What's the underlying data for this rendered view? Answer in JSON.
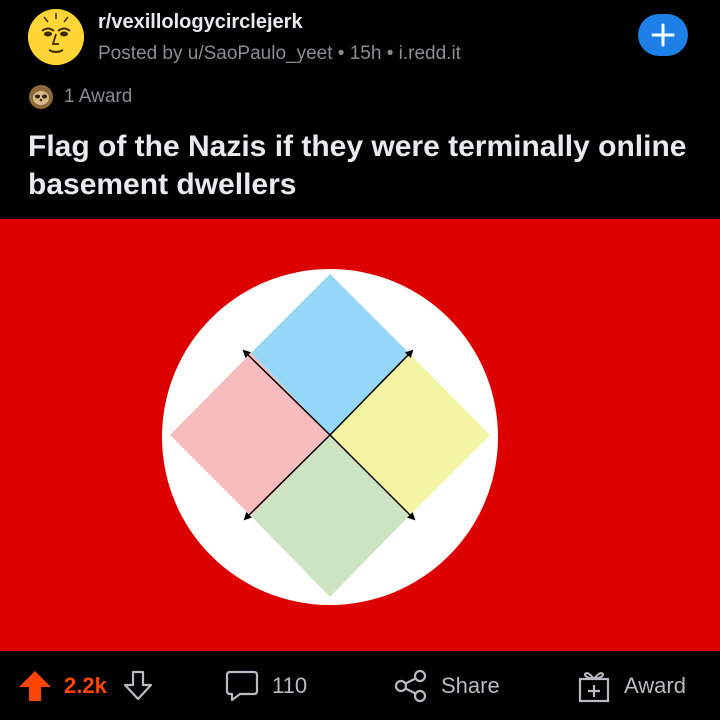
{
  "post": {
    "subreddit": "r/vexillologycirclejerk",
    "posted_by": "Posted by u/SaoPaulo_yeet",
    "age": "15h",
    "domain": "i.redd.it",
    "separator": "•",
    "awards_label": "1 Award",
    "title": "Flag of the Nazis if they were terminally online basement dwellers"
  },
  "image": {
    "background": "#dd0000",
    "circle_color": "#ffffff",
    "tile_colors": {
      "top": "#94d7f8",
      "right": "#f5f4a5",
      "bottom": "#cde4c3",
      "left": "#f9bcbe"
    }
  },
  "actions": {
    "upvote_count": "2.2k",
    "comments_count": "110",
    "share_label": "Share",
    "award_label": "Award"
  },
  "colors": {
    "accent_upvote": "#ff4500",
    "join_button": "#1e80e6"
  }
}
